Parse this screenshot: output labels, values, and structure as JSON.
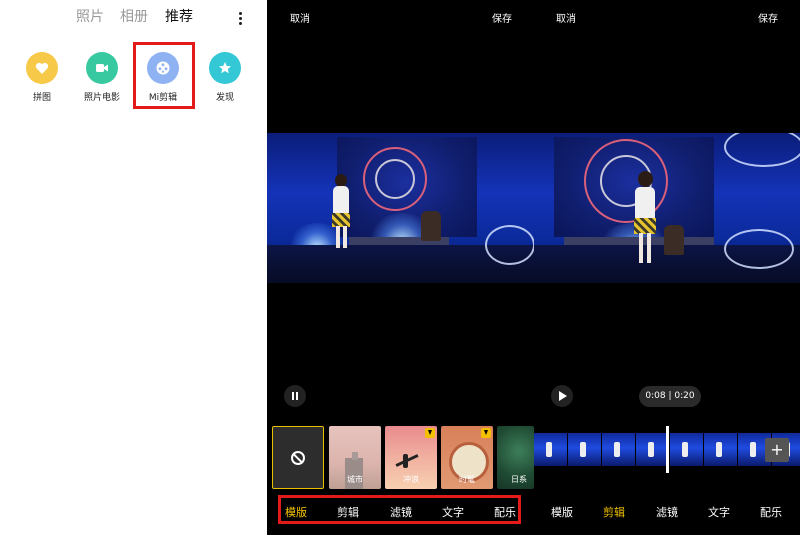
{
  "gallery": {
    "tabs": [
      {
        "label": "照片",
        "active": false
      },
      {
        "label": "相册",
        "active": false
      },
      {
        "label": "推荐",
        "active": true
      }
    ],
    "apps": [
      {
        "label": "拼图",
        "icon": "heart-icon",
        "color": "#f7c948"
      },
      {
        "label": "照片电影",
        "icon": "video-camera-icon",
        "color": "#39c9a0"
      },
      {
        "label": "Mi剪辑",
        "icon": "film-reel-icon",
        "color": "#8fb3f2"
      },
      {
        "label": "发现",
        "icon": "star-icon",
        "color": "#34c7d6"
      }
    ],
    "highlighted_app": "Mi剪辑"
  },
  "editor_template": {
    "cancel_label": "取消",
    "save_label": "保存",
    "playback": "paused",
    "templates": [
      {
        "label": "",
        "type": "none",
        "selected": true
      },
      {
        "label": "城市",
        "downloaded": true
      },
      {
        "label": "冲浪",
        "downloaded": false
      },
      {
        "label": "时髦",
        "downloaded": false
      },
      {
        "label": "日系",
        "downloaded": true
      }
    ],
    "menu": [
      {
        "label": "模版",
        "active": true
      },
      {
        "label": "剪辑",
        "active": false
      },
      {
        "label": "滤镜",
        "active": false
      },
      {
        "label": "文字",
        "active": false
      },
      {
        "label": "配乐",
        "active": false
      }
    ]
  },
  "editor_clip": {
    "cancel_label": "取消",
    "save_label": "保存",
    "playback": "stopped",
    "timecode": "0:08 | 0:20",
    "add_clip_label": "+",
    "menu": [
      {
        "label": "模版",
        "active": false
      },
      {
        "label": "剪辑",
        "active": true
      },
      {
        "label": "滤镜",
        "active": false
      },
      {
        "label": "文字",
        "active": false
      },
      {
        "label": "配乐",
        "active": false
      }
    ]
  },
  "colors": {
    "highlight_box": "#e21a1a",
    "active_menu": "#f5c400",
    "editor_bg": "#000000"
  }
}
